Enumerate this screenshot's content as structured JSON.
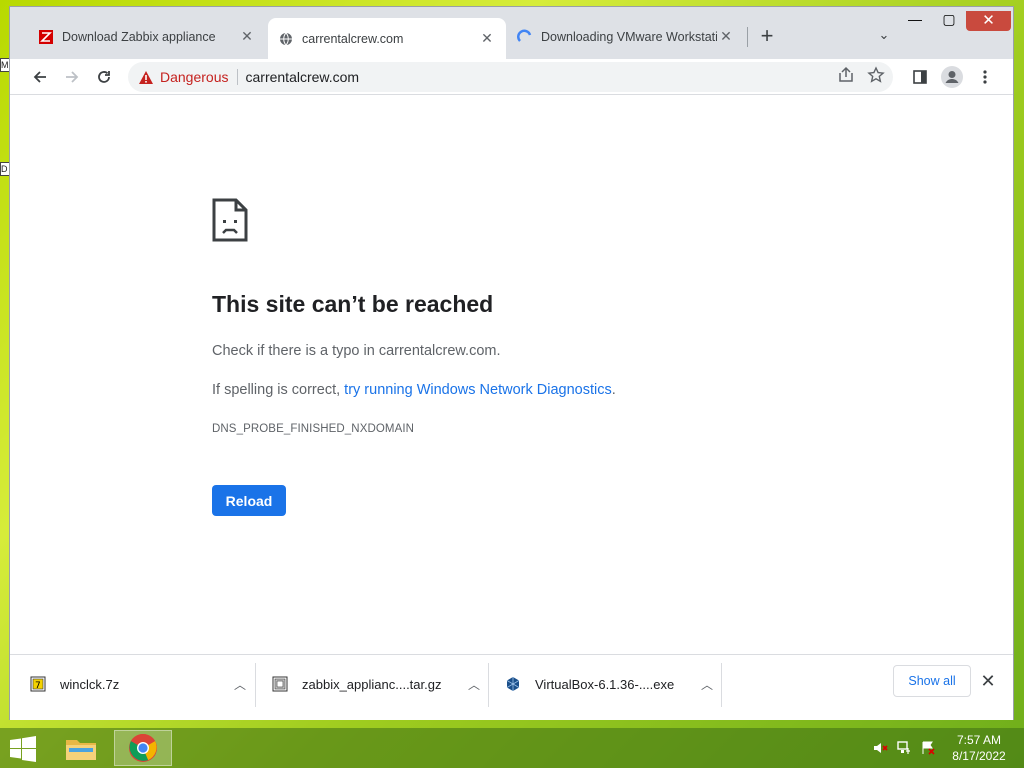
{
  "desktop": {
    "edge_icon_1": "M",
    "edge_icon_2": "D"
  },
  "tabs": [
    {
      "title": "Download Zabbix appliance",
      "favicon": "zabbix-icon"
    },
    {
      "title": "carrentalcrew.com",
      "favicon": "globe-icon",
      "active": true
    },
    {
      "title": "Downloading VMware Workstatio",
      "favicon": "vmware-icon"
    }
  ],
  "window_controls": {
    "minimize": "—",
    "maximize": "▢",
    "close": "✕"
  },
  "toolbar": {
    "security_label": "Dangerous",
    "url": "carrentalcrew.com"
  },
  "error_page": {
    "title": "This site can’t be reached",
    "line1": "Check if there is a typo in carrentalcrew.com.",
    "line2_prefix": "If spelling is correct, ",
    "line2_link": "try running Windows Network Diagnostics",
    "line2_suffix": ".",
    "code": "DNS_PROBE_FINISHED_NXDOMAIN",
    "reload_label": "Reload"
  },
  "downloads": [
    {
      "name": "winclck.7z",
      "icon": "archive-icon"
    },
    {
      "name": "zabbix_applianc....tar.gz",
      "icon": "archive-icon"
    },
    {
      "name": "VirtualBox-6.1.36-....exe",
      "icon": "virtualbox-icon"
    }
  ],
  "shelf": {
    "show_all_label": "Show all"
  },
  "taskbar": {
    "time": "7:57 AM",
    "date": "8/17/2022"
  },
  "colors": {
    "accent": "#1a73e8",
    "danger": "#c5221f"
  }
}
